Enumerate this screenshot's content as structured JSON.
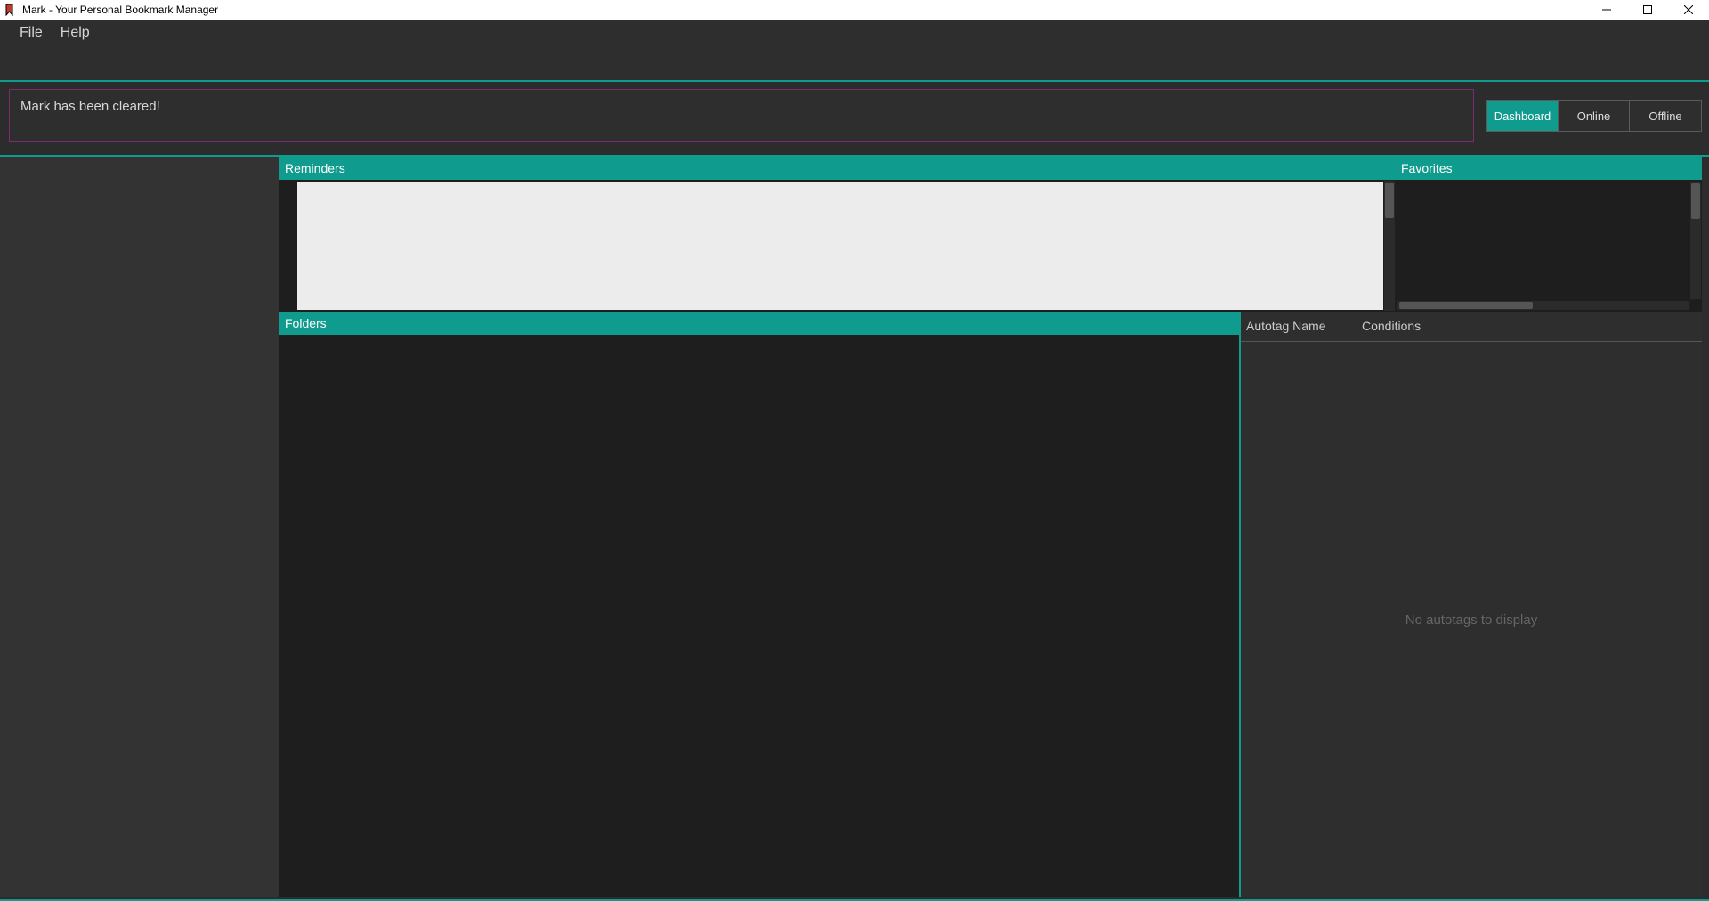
{
  "window": {
    "title": "Mark - Your Personal Bookmark Manager"
  },
  "menubar": {
    "file": "File",
    "help": "Help"
  },
  "notification": {
    "message": "Mark has been cleared!"
  },
  "tabs": {
    "dashboard": "Dashboard",
    "online": "Online",
    "offline": "Offline",
    "active": "dashboard"
  },
  "panels": {
    "reminders_title": "Reminders",
    "favorites_title": "Favorites",
    "folders_title": "Folders"
  },
  "autotags": {
    "col_name": "Autotag Name",
    "col_conditions": "Conditions",
    "empty_message": "No autotags to display"
  },
  "colors": {
    "accent": "#0f9b8e",
    "notification_border": "#7a2a6e"
  }
}
